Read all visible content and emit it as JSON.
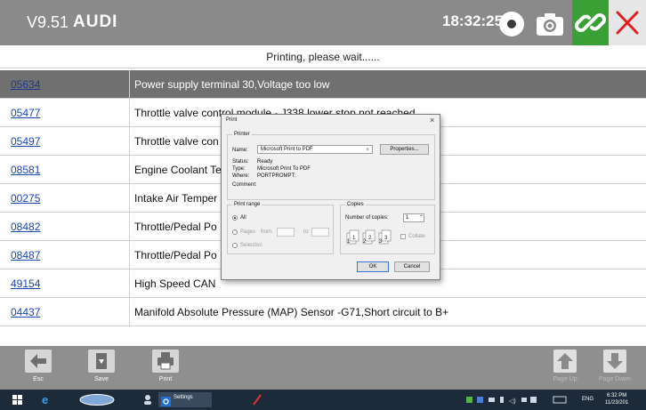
{
  "header": {
    "version": "V9.51",
    "brand": "AUDI",
    "time": "18:32:25",
    "icons": [
      "record-icon",
      "camera-icon",
      "link-icon",
      "close-icon"
    ],
    "colors": {
      "link_bg": "#3aa035",
      "close_x": "#e02020"
    }
  },
  "status": "Printing, please wait......",
  "dtc_rows": [
    {
      "code": "05634",
      "description": "Power supply terminal 30,Voltage too low",
      "selected": true
    },
    {
      "code": "05477",
      "description": "Throttle valve control module - J338 lower stop not reached"
    },
    {
      "code": "05497",
      "description": "Throttle valve con"
    },
    {
      "code": "08581",
      "description": "Engine Coolant Te"
    },
    {
      "code": "00275",
      "description": "Intake Air Temper"
    },
    {
      "code": "08482",
      "description": "Throttle/Pedal Po"
    },
    {
      "code": "08487",
      "description": "Throttle/Pedal Po"
    },
    {
      "code": "49154",
      "description": "High Speed CAN"
    },
    {
      "code": "04437",
      "description": "Manifold Absolute Pressure (MAP) Sensor -G71,Short circuit to B+"
    }
  ],
  "toolbar": {
    "esc": "Esc",
    "save": "Save",
    "print": "Print",
    "page_up": "Page Up",
    "page_down": "Page Down"
  },
  "print_dialog": {
    "title": "Print",
    "printer_group": "Printer",
    "name_label": "Name:",
    "name_value": "Microsoft Print to PDF",
    "properties_button": "Properties...",
    "status_label": "Status:",
    "status_value": "Ready",
    "type_label": "Type:",
    "type_value": "Microsoft Print To PDF",
    "where_label": "Where:",
    "where_value": "PORTPROMPT:",
    "comment_label": "Comment:",
    "range_group": "Print range",
    "range_all": "All",
    "range_pages": "Pages",
    "range_from": "from:",
    "range_to": "to:",
    "range_selection": "Selection",
    "copies_group": "Copies",
    "copies_label": "Number of copies:",
    "copies_value": "1",
    "collate_label": "Collate",
    "ok_button": "OK",
    "cancel_button": "Cancel"
  },
  "taskbar": {
    "settings_app": "Settings",
    "language": "ENG",
    "clock_time": "6:32 PM",
    "clock_date": "11/23/201"
  }
}
